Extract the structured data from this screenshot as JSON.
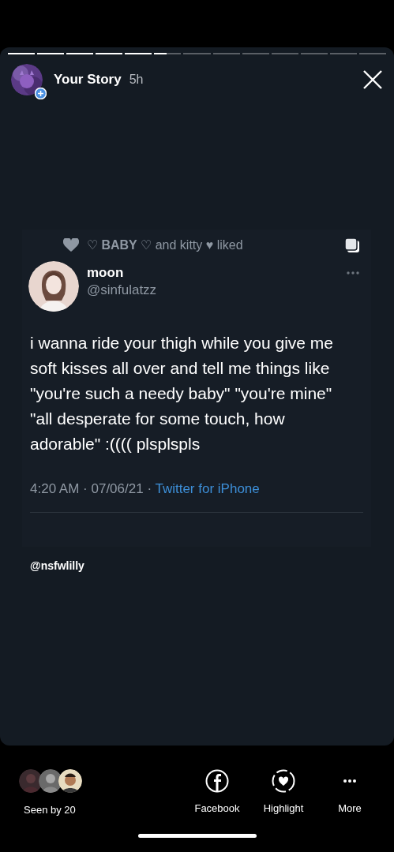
{
  "progress": [
    {
      "level": 1
    },
    {
      "level": 1
    },
    {
      "level": 1
    },
    {
      "level": 1
    },
    {
      "level": 1
    },
    {
      "level": 0.45
    },
    {
      "level": 0
    },
    {
      "level": 0
    },
    {
      "level": 0
    },
    {
      "level": 0
    },
    {
      "level": 0
    },
    {
      "level": 0
    },
    {
      "level": 0
    }
  ],
  "header": {
    "title": "Your Story",
    "time": "5h"
  },
  "tweet": {
    "liked_by": "♡ **BABY** ♡ and kitty ♥ liked",
    "author": {
      "name": "moon",
      "handle": "@sinfulatzz"
    },
    "text": "i wanna ride your thigh while you give me soft kisses all over and tell me things like \"you're such a needy baby\" \"you're mine\" \"all desperate for some touch, how adorable\" :(((( plsplspls",
    "meta": {
      "time": "4:20 AM · 07/06/21 ·",
      "source": "Twitter for iPhone"
    }
  },
  "caption": "@nsfwlilly",
  "footer": {
    "seen": "Seen by 20",
    "actions": [
      {
        "kind": "facebook",
        "label": "Facebook"
      },
      {
        "kind": "highlight",
        "label": "Highlight"
      },
      {
        "kind": "more",
        "label": "More"
      }
    ]
  }
}
